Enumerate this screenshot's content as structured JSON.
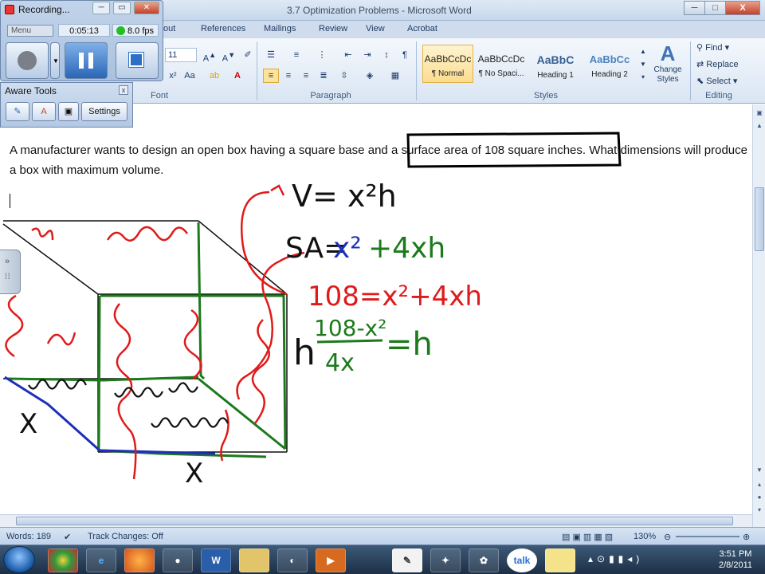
{
  "window": {
    "title": "3.7 Optimization Problems - Microsoft Word",
    "minimize": "─",
    "maximize": "□",
    "close": "X"
  },
  "ribbon": {
    "tabs": [
      "out",
      "References",
      "Mailings",
      "Review",
      "View",
      "Acrobat"
    ],
    "font_size": "11",
    "groups": {
      "font": "Font",
      "paragraph": "Paragraph",
      "styles": "Styles",
      "editing": "Editing"
    },
    "styles": [
      {
        "sample": "AaBbCcDc",
        "name": "¶ Normal"
      },
      {
        "sample": "AaBbCcDc",
        "name": "¶ No Spaci..."
      },
      {
        "sample": "AaBbC",
        "name": "Heading 1"
      },
      {
        "sample": "AaBbCc",
        "name": "Heading 2"
      }
    ],
    "change_styles": "Change Styles",
    "editing": {
      "find": "Find",
      "replace": "Replace",
      "select": "Select"
    }
  },
  "document": {
    "problem_text": "A manufacturer wants to design an open box having a square base and a surface area of 108 square inches. What dimensions will produce a box with maximum volume."
  },
  "ink": {
    "volume_eq": "V= x²h",
    "sa_eq_left": "SA=",
    "sa_x2": "x²",
    "sa_rest": "+4xh",
    "eq_108": "108=x²+4xh",
    "h_left": "h",
    "fraction_num": "108-x²",
    "fraction_den": "4x",
    "fraction_rhs": "=h",
    "side_label_left": "X",
    "side_label_bottom": "X"
  },
  "status": {
    "words": "Words: 189",
    "track_changes": "Track Changes: Off",
    "zoom": "130%"
  },
  "taskbar": {
    "time": "3:51 PM",
    "date": "2/8/2011",
    "word_icon": "W"
  },
  "recorder": {
    "title": "Recording...",
    "menu_label": "Menu",
    "elapsed": "0:05:13",
    "fps": "8.0 fps"
  },
  "aware_tools": {
    "title": "Aware Tools",
    "settings_label": "Settings"
  }
}
